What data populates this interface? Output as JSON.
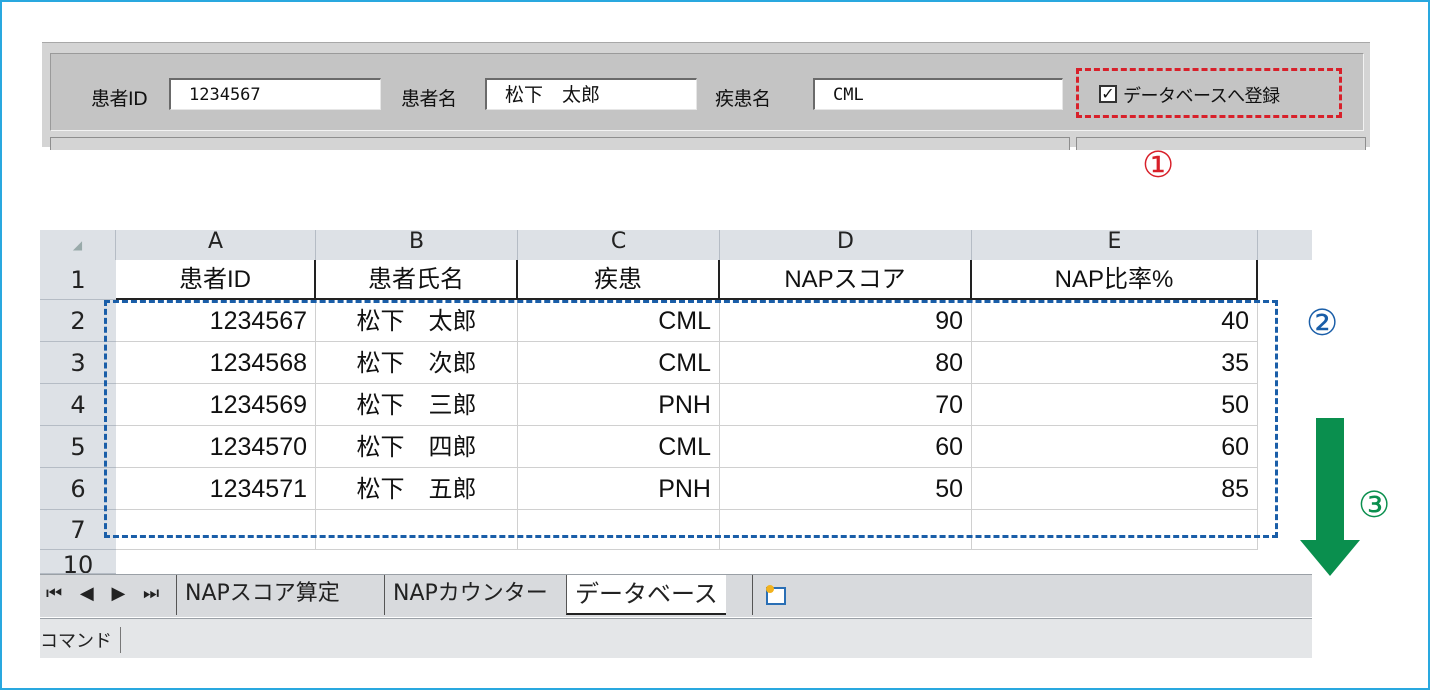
{
  "form": {
    "patient_id_label": "患者ID",
    "patient_id_value": "1234567",
    "patient_name_label": "患者名",
    "patient_name_value": "松下　太郎",
    "disease_label": "疾患名",
    "disease_value": "CML",
    "register_checkbox_label": "データベースへ登録",
    "register_checkbox_checked": true
  },
  "annotations": {
    "n1": "①",
    "n2": "②",
    "n3": "③",
    "n1_color": "#d8202a",
    "n2_color": "#1a5ea8",
    "n3_color": "#0a8f4e"
  },
  "sheet": {
    "corner": "◢",
    "columns": [
      "A",
      "B",
      "C",
      "D",
      "E"
    ],
    "row_numbers": [
      "1",
      "2",
      "3",
      "4",
      "5",
      "6",
      "7",
      "10"
    ],
    "header_row": [
      "患者ID",
      "患者氏名",
      "疾患",
      "NAPスコア",
      "NAP比率%"
    ],
    "rows": [
      [
        "1234567",
        "松下　太郎",
        "CML",
        "90",
        "40"
      ],
      [
        "1234568",
        "松下　次郎",
        "CML",
        "80",
        "35"
      ],
      [
        "1234569",
        "松下　三郎",
        "PNH",
        "70",
        "50"
      ],
      [
        "1234570",
        "松下　四郎",
        "CML",
        "60",
        "60"
      ],
      [
        "1234571",
        "松下　五郎",
        "PNH",
        "50",
        "85"
      ]
    ],
    "tab_nav": "⏮ ◀ ▶ ⏭",
    "tabs": [
      "NAPスコア算定",
      "NAPカウンター",
      "データベース"
    ],
    "active_tab": "データベース",
    "status": "コマンド"
  }
}
